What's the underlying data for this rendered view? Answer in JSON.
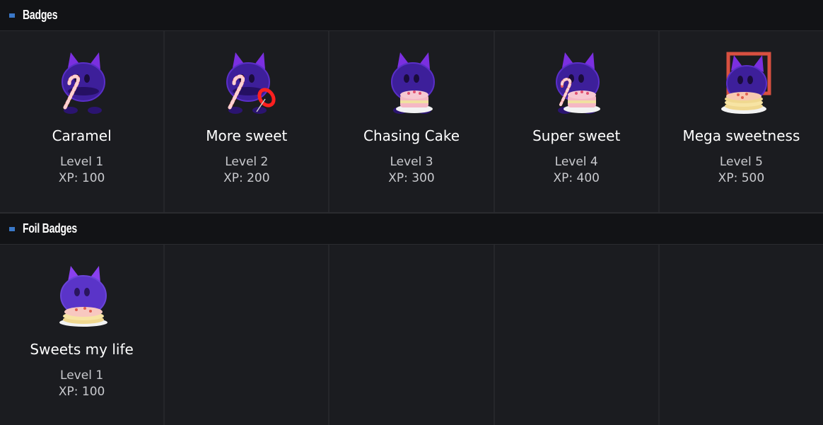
{
  "sections": {
    "badges": {
      "title": "Badges",
      "items": [
        {
          "name": "Caramel",
          "level": "Level 1",
          "xp": "XP: 100",
          "icon": "cat-candy-cane-badge-icon"
        },
        {
          "name": "More sweet",
          "level": "Level 2",
          "xp": "XP: 200",
          "icon": "cat-candy-cane-pin-badge-icon"
        },
        {
          "name": "Chasing Cake",
          "level": "Level 3",
          "xp": "XP: 300",
          "icon": "cat-cake-badge-icon"
        },
        {
          "name": "Super sweet",
          "level": "Level 4",
          "xp": "XP: 400",
          "icon": "cat-cake-candy-cane-badge-icon"
        },
        {
          "name": "Mega sweetness",
          "level": "Level 5",
          "xp": "XP: 500",
          "icon": "cat-pancake-frame-badge-icon"
        }
      ]
    },
    "foil": {
      "title": "Foil Badges",
      "items": [
        {
          "name": "Sweets my life",
          "level": "Level 1",
          "xp": "XP: 100",
          "icon": "cat-pancake-foil-badge-icon"
        }
      ]
    }
  },
  "colors": {
    "background": "#1b1c20",
    "header": "#121316",
    "accent": "#3a78c8",
    "cat": "#3d1f9a",
    "ears": "#7b2fe0"
  }
}
